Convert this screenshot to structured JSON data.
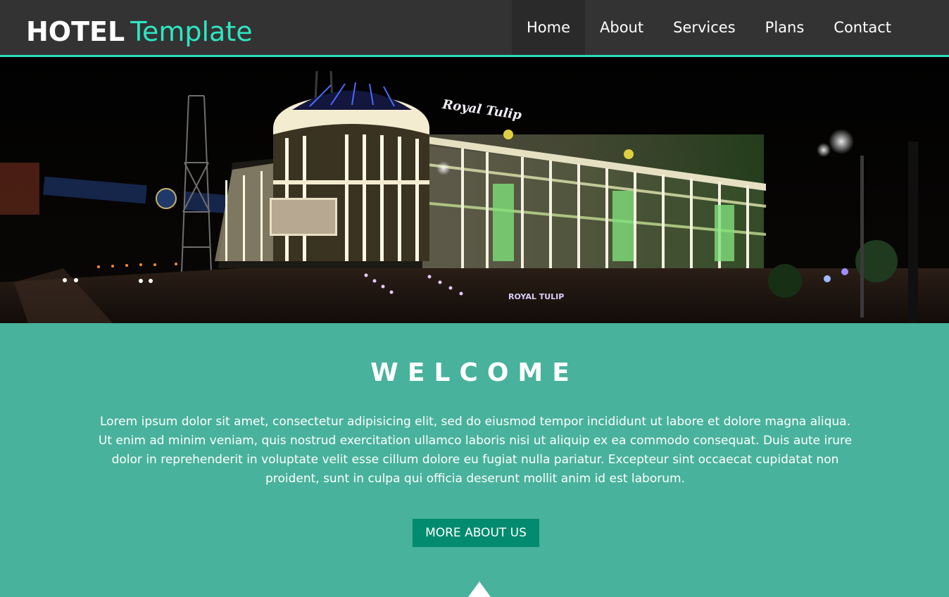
{
  "header": {
    "logo_brand": "HOTEL",
    "logo_accent": "Template",
    "nav": [
      {
        "label": "Home",
        "active": true
      },
      {
        "label": "About",
        "active": false
      },
      {
        "label": "Services",
        "active": false
      },
      {
        "label": "Plans",
        "active": false
      },
      {
        "label": "Contact",
        "active": false
      }
    ]
  },
  "hero": {
    "sign_text": "Royal Tulip",
    "ground_sign_text": "ROYAL TULIP"
  },
  "welcome": {
    "title": "WELCOME",
    "body": "Lorem ipsum dolor sit amet, consectetur adipisicing elit, sed do eiusmod tempor incididunt ut labore et dolore magna aliqua. Ut enim ad minim veniam, quis nostrud exercitation ullamco laboris nisi ut aliquip ex ea commodo consequat. Duis aute irure dolor in reprehenderit in voluptate velit esse cillum dolore eu fugiat nulla pariatur. Excepteur sint occaecat cupidatat non proident, sunt in culpa qui officia deserunt mollit anim id est laborum.",
    "button_label": "MORE ABOUT US"
  },
  "colors": {
    "header_bg": "#333333",
    "accent": "#2fdcb6",
    "section_bg": "#48b29c",
    "button_bg": "#028b6e"
  }
}
